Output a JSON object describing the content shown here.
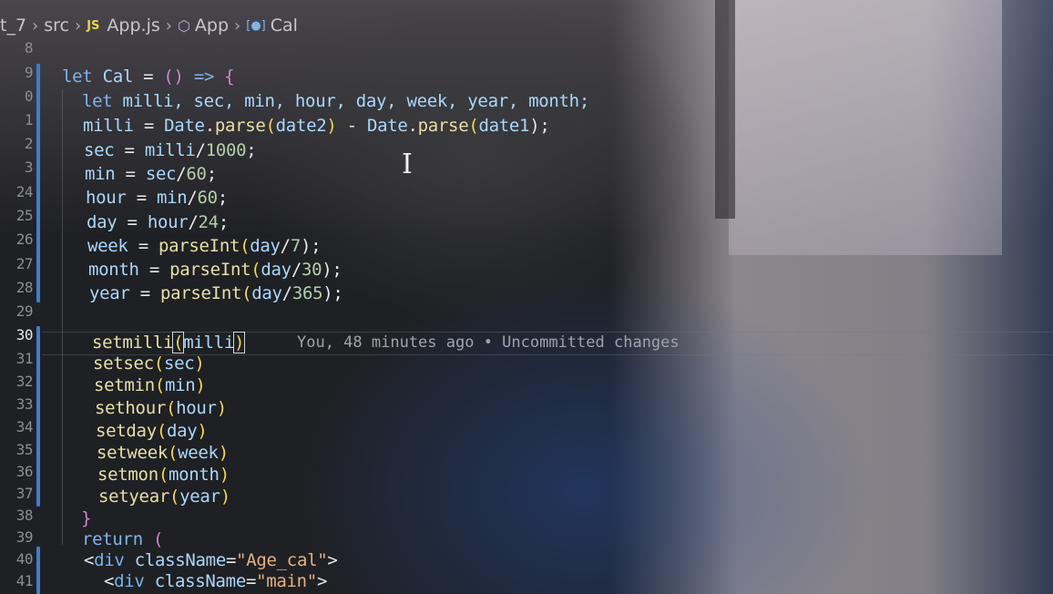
{
  "breadcrumb": {
    "root": "t_7",
    "folder": "src",
    "file_badge": "JS",
    "file": "App.js",
    "symbol": "App",
    "sub_symbol": "Cal"
  },
  "line_numbers": [
    "8",
    "9",
    "0",
    "1",
    "2",
    "3",
    "24",
    "25",
    "26",
    "27",
    "28",
    "29",
    "30",
    "31",
    "32",
    "33",
    "34",
    "35",
    "36",
    "37",
    "38",
    "39",
    "40",
    "41"
  ],
  "active_line": "30",
  "code": {
    "l19": [
      "let",
      " ",
      "Cal",
      " = ",
      "()",
      " => ",
      "{"
    ],
    "l20": [
      "let",
      " milli, sec, min, hour, day, week, year, month;"
    ],
    "l21": [
      "milli",
      " = ",
      "Date",
      ".",
      "parse",
      "(",
      "date2",
      ")",
      " - ",
      "Date",
      ".",
      "parse",
      "(",
      "date1",
      ");"
    ],
    "l22": [
      "sec",
      " = ",
      "milli",
      "/",
      "1000",
      ";"
    ],
    "l23": [
      "min",
      " = ",
      "sec",
      "/",
      "60",
      ";"
    ],
    "l24": [
      "hour",
      " = ",
      "min",
      "/",
      "60",
      ";"
    ],
    "l25": [
      "day",
      " = ",
      "hour",
      "/",
      "24",
      ";"
    ],
    "l26": [
      "week",
      " = ",
      "parseInt",
      "(",
      "day",
      "/",
      "7",
      ");"
    ],
    "l27": [
      "month",
      " = ",
      "parseInt",
      "(",
      "day",
      "/",
      "30",
      ");"
    ],
    "l28": [
      "year",
      " = ",
      "parseInt",
      "(",
      "day",
      "/",
      "365",
      ");"
    ],
    "l30": [
      "setmilli",
      "(",
      "milli",
      ")"
    ],
    "l31": [
      "setsec",
      "(",
      "sec",
      ")"
    ],
    "l32": [
      "setmin",
      "(",
      "min",
      ")"
    ],
    "l33": [
      "sethour",
      "(",
      "hour",
      ")"
    ],
    "l34": [
      "setday",
      "(",
      "day",
      ")"
    ],
    "l35": [
      "setweek",
      "(",
      "week",
      ")"
    ],
    "l36": [
      "setmon",
      "(",
      "month",
      ")"
    ],
    "l37": [
      "setyear",
      "(",
      "year",
      ")"
    ],
    "l38": [
      "}"
    ],
    "l39": [
      "return",
      " ",
      "("
    ],
    "l40": [
      "<",
      "div",
      " ",
      "className",
      "=",
      "\"Age_cal\"",
      ">"
    ],
    "l41": [
      "<",
      "div",
      " ",
      "className",
      "=",
      "\"main\"",
      ">"
    ]
  },
  "blame": "You, 48 minutes ago • Uncommitted changes",
  "colors": {
    "keyword": "#7fb3f0",
    "function": "#e4e0a6",
    "variable": "#a8d8ff",
    "number": "#b5cea8",
    "string": "#e6b080",
    "git_modified": "#3a7fd0",
    "js_badge": "#e8d44d"
  },
  "icons": {
    "file": "js-file-icon",
    "symbol": "cube-icon",
    "sub_symbol": "variable-icon",
    "cursor": "text-cursor-icon"
  }
}
